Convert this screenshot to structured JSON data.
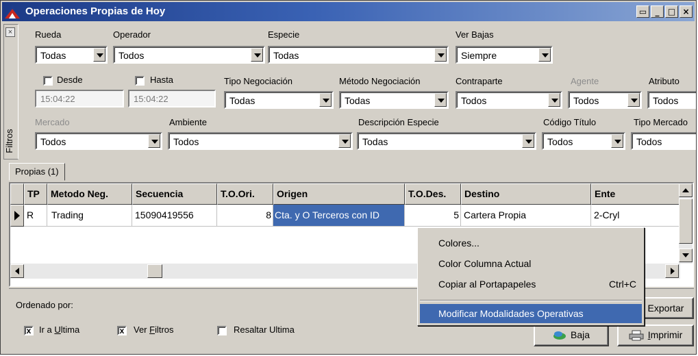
{
  "window": {
    "title": "Operaciones Propias de Hoy",
    "controls": [
      "restore",
      "minimize",
      "maximize",
      "close"
    ]
  },
  "filters": {
    "strip_label": "Filtros",
    "rueda": {
      "label": "Rueda",
      "value": "Todas"
    },
    "operador": {
      "label": "Operador",
      "value": "Todos"
    },
    "especie": {
      "label": "Especie",
      "value": "Todas"
    },
    "ver_bajas": {
      "label": "Ver Bajas",
      "value": "Siempre"
    },
    "desde": {
      "label": "Desde",
      "value": "15:04:22",
      "checked": false
    },
    "hasta": {
      "label": "Hasta",
      "value": "15:04:22",
      "checked": false
    },
    "tipo_negociacion": {
      "label": "Tipo Negociación",
      "value": "Todas"
    },
    "metodo_negociacion": {
      "label": "Método Negociación",
      "value": "Todas"
    },
    "contraparte": {
      "label": "Contraparte",
      "value": "Todos"
    },
    "agente": {
      "label": "Agente",
      "value": "Todos"
    },
    "atributo": {
      "label": "Atributo",
      "value": "Todos"
    },
    "mercado": {
      "label": "Mercado",
      "value": "Todos"
    },
    "ambiente": {
      "label": "Ambiente",
      "value": "Todos"
    },
    "descripcion_especie": {
      "label": "Descripción Especie",
      "value": "Todas"
    },
    "codigo_titulo": {
      "label": "Código Título",
      "value": "Todos"
    },
    "tipo_mercado": {
      "label": "Tipo Mercado",
      "value": "Todos"
    }
  },
  "tabs": [
    {
      "label": "Propias (1)"
    }
  ],
  "grid": {
    "columns": [
      "TP",
      "Metodo Neg.",
      "Secuencia",
      "T.O.Ori.",
      "Origen",
      "T.O.Des.",
      "Destino",
      "Ente"
    ],
    "rows": [
      {
        "tp": "R",
        "metodo": "Trading",
        "secuencia": "15090419556",
        "to_ori": "8",
        "origen": "Cta. y O Terceros con ID",
        "to_des": "5",
        "destino": "Cartera Propia",
        "ente": "2-Cryl"
      }
    ]
  },
  "bottom": {
    "ordenado_por_label": "Ordenado por:",
    "ir_a_ultima": {
      "label_pre": "Ir a ",
      "label_u": "U",
      "label_post": "ltima",
      "checked": true
    },
    "ver_filtros": {
      "label_pre": "Ver ",
      "label_u": "F",
      "label_post": "iltros",
      "checked": true
    },
    "resaltar_ultima": {
      "label": "Resaltar Ultima",
      "checked": false
    },
    "exportar": "Exportar",
    "baja": "Baja",
    "imprimir_u": "I",
    "imprimir_rest": "mprimir"
  },
  "context_menu": {
    "items": [
      {
        "label": "Colores...",
        "shortcut": ""
      },
      {
        "label": "Color Columna Actual",
        "shortcut": ""
      },
      {
        "label": "Copiar al Portapapeles",
        "shortcut": "Ctrl+C"
      },
      {
        "label": "Modificar Modalidades Operativas",
        "shortcut": "",
        "highlighted": true
      }
    ]
  },
  "colors": {
    "title_start": "#1c3a86",
    "title_end": "#8aa6d4",
    "selection": "#3f69b0",
    "face": "#d4d0c8"
  }
}
